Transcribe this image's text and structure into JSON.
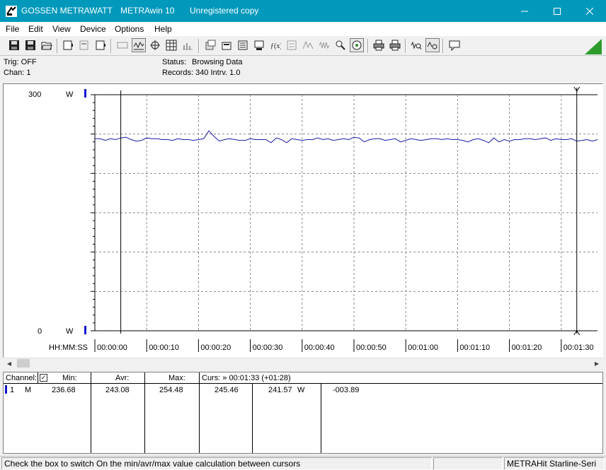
{
  "window": {
    "company": "GOSSEN METRAWATT",
    "app": "METRAwin 10",
    "license": "Unregistered copy",
    "minimize_icon": "minimize-icon",
    "maximize_icon": "maximize-icon",
    "close_icon": "close-icon"
  },
  "menu": [
    "File",
    "Edit",
    "View",
    "Device",
    "Options",
    "Help"
  ],
  "toolbar": {
    "icons": [
      "save-icon",
      "save-as-icon",
      "open-folder-icon",
      "device-icon",
      "device-disabled-icon",
      "device-settings-icon",
      "keyboard-icon",
      "graph-view-icon",
      "cursor-crosshair-icon",
      "table-view-icon",
      "bar-view-icon",
      "export-icon",
      "import-icon",
      "list-icon",
      "print-preview-icon",
      "formula-icon",
      "statistics-icon",
      "trigger-icon",
      "waveform-icon",
      "zoom-in-icon",
      "settings-icon",
      "print-icon",
      "printer-setup-icon",
      "zoom-wave-icon",
      "cursor-wave-icon",
      "message-icon"
    ],
    "corner_icon": "green-triangle-icon"
  },
  "status": {
    "trig": "Trig: OFF",
    "chan": "Chan:  1",
    "status_label": "Status:",
    "status_value": "Browsing Data",
    "records": "Records: 340   Intrv. 1.0"
  },
  "chart_data": {
    "type": "line",
    "y_top_label": "300",
    "y_bottom_label": "0",
    "unit": "W",
    "ylim": [
      0,
      300
    ],
    "x_axis_label": "HH:MM:SS",
    "x_ticks": [
      "00:00:00",
      "00:00:10",
      "00:00:20",
      "00:00:30",
      "00:00:40",
      "00:00:50",
      "00:01:00",
      "00:01:10",
      "00:01:20",
      "00:01:30"
    ],
    "xlim_seconds": [
      0,
      97
    ],
    "cursor_left_seconds": 5,
    "cursor_right_seconds": 93,
    "series": [
      {
        "color": "#1a1aa6",
        "x": [
          0,
          1,
          2,
          3,
          4,
          5,
          6,
          7,
          8,
          9,
          10,
          11,
          12,
          13,
          14,
          15,
          16,
          17,
          18,
          19,
          20,
          21,
          22,
          23,
          24,
          25,
          26,
          27,
          28,
          29,
          30,
          31,
          32,
          33,
          34,
          35,
          36,
          37,
          38,
          39,
          40,
          41,
          42,
          43,
          44,
          45,
          46,
          47,
          48,
          49,
          50,
          51,
          52,
          53,
          54,
          55,
          56,
          57,
          58,
          59,
          60,
          61,
          62,
          63,
          64,
          65,
          66,
          67,
          68,
          69,
          70,
          71,
          72,
          73,
          74,
          75,
          76,
          77,
          78,
          79,
          80,
          81,
          82,
          83,
          84,
          85,
          86,
          87,
          88,
          89,
          90,
          91,
          92,
          93,
          94,
          95,
          96,
          97
        ],
        "y": [
          244,
          244,
          242,
          244,
          243,
          245,
          246,
          243,
          241,
          242,
          245,
          244,
          244,
          243,
          243,
          242,
          244,
          243,
          243,
          242,
          243,
          244,
          254,
          247,
          241,
          243,
          244,
          243,
          242,
          242,
          244,
          243,
          243,
          243,
          239,
          245,
          243,
          239,
          244,
          243,
          242,
          243,
          243,
          245,
          243,
          244,
          242,
          243,
          244,
          243,
          246,
          245,
          240,
          243,
          244,
          244,
          242,
          243,
          244,
          240,
          242,
          244,
          243,
          242,
          243,
          244,
          244,
          243,
          244,
          243,
          243,
          242,
          240,
          243,
          244,
          242,
          239,
          245,
          240,
          243,
          241,
          243,
          243,
          244,
          244,
          243,
          244,
          245,
          242,
          244,
          243,
          243,
          244,
          241,
          242,
          243,
          241,
          243
        ]
      }
    ]
  },
  "table": {
    "headers": {
      "channel": "Channel:",
      "min": "Min:",
      "avr": "Avr:",
      "max": "Max:",
      "curs": "Curs: » 00:01:33 (+01:28)"
    },
    "checkbox_checked": "✓",
    "row": {
      "channel_no": "1",
      "mode": "M",
      "min": "236.68",
      "avr": "243.08",
      "max": "254.48",
      "cursor1": "245.46",
      "cursor2": "241.57",
      "unit": "W",
      "delta": "-003.89"
    }
  },
  "statusbar": {
    "hint": "Check the box to switch On the min/avr/max value calculation between cursors",
    "device": "METRAHit Starline-Seri"
  }
}
